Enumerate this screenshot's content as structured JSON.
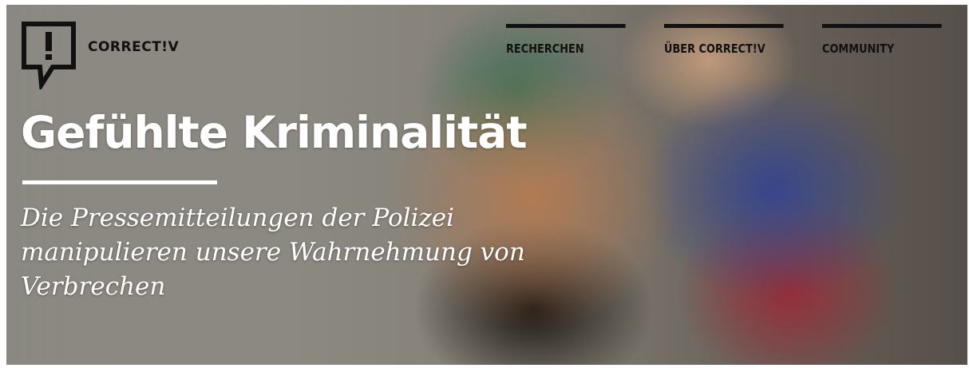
{
  "brand": {
    "logo_text": "CORRECT!V",
    "logo_icon": "speech-bubble-exclamation-icon"
  },
  "nav": {
    "items": [
      {
        "label": "RECHERCHEN"
      },
      {
        "label": "ÜBER CORRECT!V"
      },
      {
        "label": "COMMUNITY"
      }
    ]
  },
  "hero": {
    "title": "Gefühlte Kriminalität",
    "subtitle": "Die Pressemitteilungen der Polizei manipulieren unsere Wahrnehmung von Verbrechen",
    "image_subject": "hand-puppets-photo"
  },
  "colors": {
    "nav_text": "#111111",
    "title_text": "#ffffff",
    "divider": "#ffffff"
  }
}
